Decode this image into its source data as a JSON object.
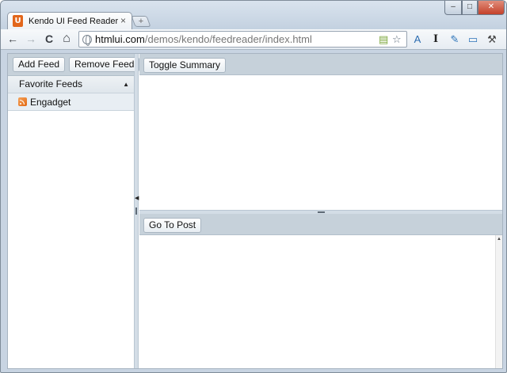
{
  "browser": {
    "tab_title": "Kendo UI Feed Reader",
    "tab_favicon_letter": "U",
    "new_tab_symbol": "+",
    "close_tab_symbol": "×",
    "window_controls": {
      "minimize": "–",
      "maximize": "□",
      "close": "✕"
    },
    "url_host": "htmlui.com",
    "url_path": "/demos/kendo/feedreader/index.html",
    "nav_icons": {
      "back": "←",
      "forward": "→",
      "reload": "C",
      "home": "⌂"
    },
    "extension_icons": [
      "translate-icon",
      "text-cursor-icon",
      "eyedropper-icon",
      "fullscreen-icon",
      "wrench-icon"
    ]
  },
  "app": {
    "left_toolbar": {
      "add_feed": "Add Feed",
      "remove_feed": "Remove Feed"
    },
    "favorites": {
      "header": "Favorite Feeds",
      "items": [
        {
          "label": "Engadget"
        }
      ]
    },
    "summary_toolbar": {
      "toggle_summary": "Toggle Summary"
    },
    "post_toolbar": {
      "go_to_post": "Go To Post"
    }
  },
  "colors": {
    "toolbar": "#c6d1da",
    "splitter": "#d3dde6",
    "favicon": "#e2661b",
    "rss": "#e26813"
  }
}
